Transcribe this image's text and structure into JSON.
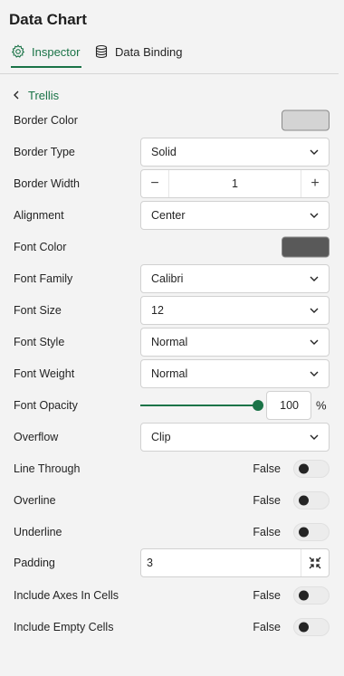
{
  "panel": {
    "title": "Data Chart"
  },
  "tabs": [
    {
      "label": "Inspector",
      "icon": "gear-icon",
      "active": true
    },
    {
      "label": "Data Binding",
      "icon": "database-icon",
      "active": false
    }
  ],
  "breadcrumb": {
    "label": "Trellis"
  },
  "accent_color": "#1a7347",
  "properties": {
    "border_color": {
      "label": "Border Color",
      "value": "#d4d4d4"
    },
    "border_type": {
      "label": "Border Type",
      "value": "Solid"
    },
    "border_width": {
      "label": "Border Width",
      "value": "1",
      "decrement": "−",
      "increment": "+"
    },
    "alignment": {
      "label": "Alignment",
      "value": "Center"
    },
    "font_color": {
      "label": "Font Color",
      "value": "#595959"
    },
    "font_family": {
      "label": "Font Family",
      "value": "Calibri"
    },
    "font_size": {
      "label": "Font Size",
      "value": "12"
    },
    "font_style": {
      "label": "Font Style",
      "value": "Normal"
    },
    "font_weight": {
      "label": "Font Weight",
      "value": "Normal"
    },
    "font_opacity": {
      "label": "Font Opacity",
      "value": "100",
      "unit": "%",
      "level": 1.0
    },
    "overflow": {
      "label": "Overflow",
      "value": "Clip"
    },
    "line_through": {
      "label": "Line Through",
      "value": "False"
    },
    "overline": {
      "label": "Overline",
      "value": "False"
    },
    "underline": {
      "label": "Underline",
      "value": "False"
    },
    "padding": {
      "label": "Padding",
      "value": "3"
    },
    "include_axes_in_cells": {
      "label": "Include Axes In Cells",
      "value": "False"
    },
    "include_empty_cells": {
      "label": "Include Empty Cells",
      "value": "False"
    }
  }
}
